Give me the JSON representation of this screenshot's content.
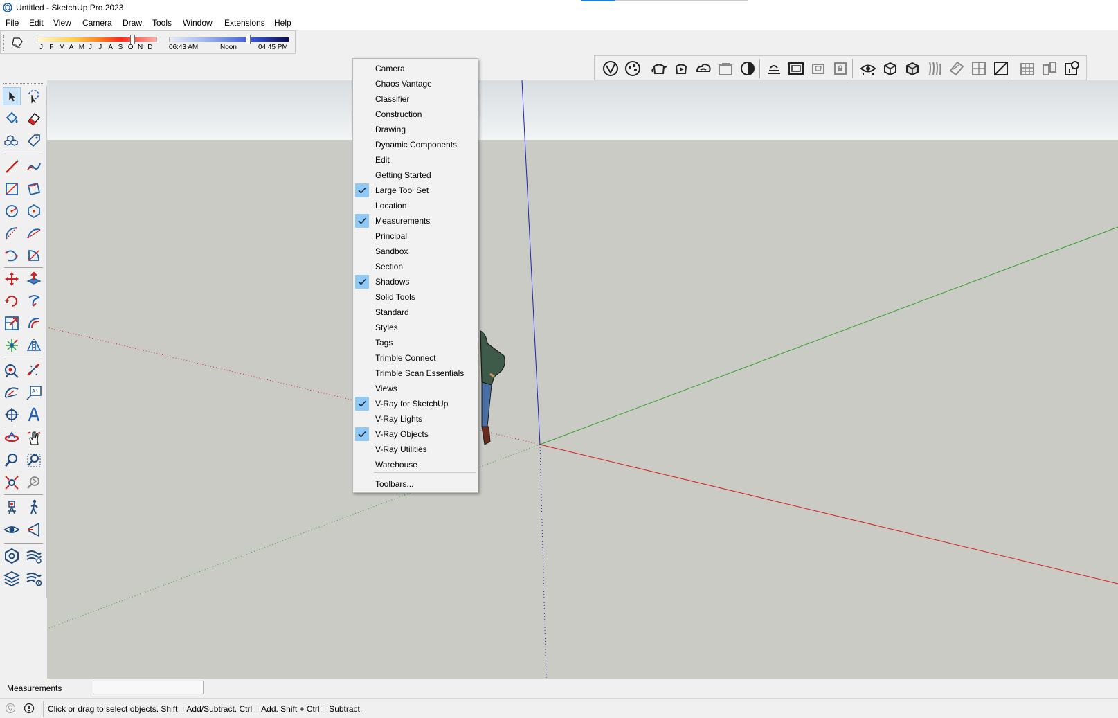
{
  "window": {
    "title": "Untitled - SketchUp Pro 2023"
  },
  "menubar": {
    "items": [
      {
        "label": "File"
      },
      {
        "label": "Edit"
      },
      {
        "label": "View"
      },
      {
        "label": "Camera"
      },
      {
        "label": "Draw"
      },
      {
        "label": "Tools"
      },
      {
        "label": "Window"
      },
      {
        "label": "Extensions"
      },
      {
        "label": "Help"
      }
    ]
  },
  "shadows_toolbar": {
    "months": [
      "J",
      "F",
      "M",
      "A",
      "M",
      "J",
      "J",
      "A",
      "S",
      "O",
      "N",
      "D"
    ],
    "date_level": 0.8,
    "time_level": 0.66,
    "time_start": "06:43 AM",
    "time_mid": "Noon",
    "time_end": "04:45 PM"
  },
  "context_menu": {
    "items": [
      {
        "label": "Camera",
        "checked": false
      },
      {
        "label": "Chaos Vantage",
        "checked": false
      },
      {
        "label": "Classifier",
        "checked": false
      },
      {
        "label": "Construction",
        "checked": false
      },
      {
        "label": "Drawing",
        "checked": false
      },
      {
        "label": "Dynamic Components",
        "checked": false
      },
      {
        "label": "Edit",
        "checked": false
      },
      {
        "label": "Getting Started",
        "checked": false
      },
      {
        "label": "Large Tool Set",
        "checked": true
      },
      {
        "label": "Location",
        "checked": false
      },
      {
        "label": "Measurements",
        "checked": true
      },
      {
        "label": "Principal",
        "checked": false
      },
      {
        "label": "Sandbox",
        "checked": false
      },
      {
        "label": "Section",
        "checked": false
      },
      {
        "label": "Shadows",
        "checked": true
      },
      {
        "label": "Solid Tools",
        "checked": false
      },
      {
        "label": "Standard",
        "checked": false
      },
      {
        "label": "Styles",
        "checked": false
      },
      {
        "label": "Tags",
        "checked": false
      },
      {
        "label": "Trimble Connect",
        "checked": false
      },
      {
        "label": "Trimble Scan Essentials",
        "checked": false
      },
      {
        "label": "Views",
        "checked": false
      },
      {
        "label": "V-Ray for SketchUp",
        "checked": true
      },
      {
        "label": "V-Ray Lights",
        "checked": false
      },
      {
        "label": "V-Ray Objects",
        "checked": true
      },
      {
        "label": "V-Ray Utilities",
        "checked": false
      },
      {
        "label": "Warehouse",
        "checked": false
      }
    ],
    "footer": "Toolbars..."
  },
  "measurements": {
    "label": "Measurements",
    "value": ""
  },
  "status": {
    "text": "Click or drag to select objects. Shift = Add/Subtract. Ctrl = Add. Shift + Ctrl = Subtract."
  },
  "colors": {
    "viewport_ground": "#cbcbc6",
    "axis_red": "#d02020",
    "axis_green": "#2aa02a",
    "axis_blue": "#2020c0",
    "menu_check": "#90c8f6"
  }
}
